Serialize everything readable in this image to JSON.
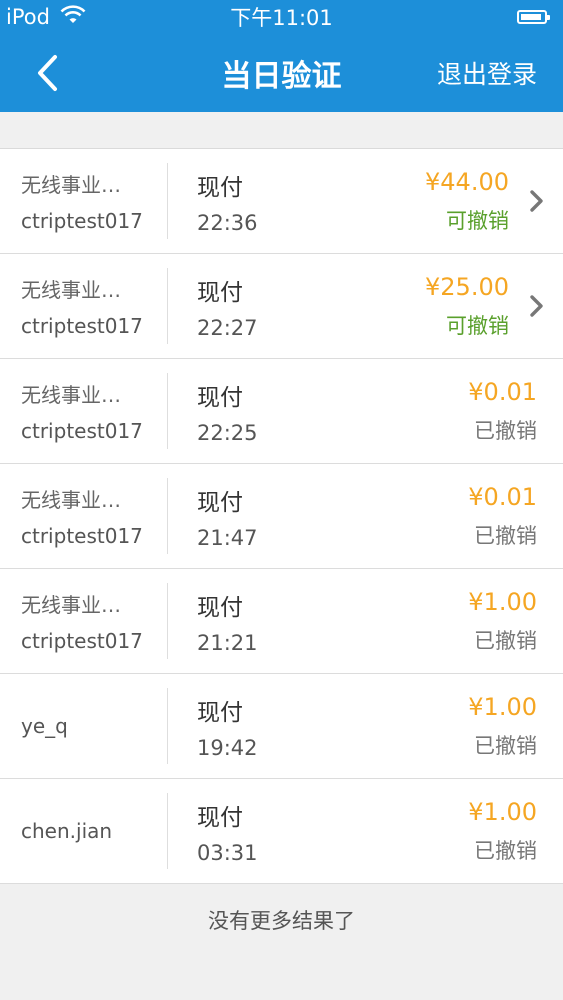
{
  "statusbar": {
    "device": "iPod",
    "time": "下午11:01"
  },
  "nav": {
    "title": "当日验证",
    "logout_label": "退出登录"
  },
  "rows": [
    {
      "merchant": "无线事业…",
      "account": "ctriptest017",
      "pay_type": "现付",
      "time": "22:36",
      "amount": "¥44.00",
      "status": "可撤销",
      "revocable": true
    },
    {
      "merchant": "无线事业…",
      "account": "ctriptest017",
      "pay_type": "现付",
      "time": "22:27",
      "amount": "¥25.00",
      "status": "可撤销",
      "revocable": true
    },
    {
      "merchant": "无线事业…",
      "account": "ctriptest017",
      "pay_type": "现付",
      "time": "22:25",
      "amount": "¥0.01",
      "status": "已撤销",
      "revocable": false
    },
    {
      "merchant": "无线事业…",
      "account": "ctriptest017",
      "pay_type": "现付",
      "time": "21:47",
      "amount": "¥0.01",
      "status": "已撤销",
      "revocable": false
    },
    {
      "merchant": "无线事业…",
      "account": "ctriptest017",
      "pay_type": "现付",
      "time": "21:21",
      "amount": "¥1.00",
      "status": "已撤销",
      "revocable": false
    },
    {
      "merchant": "",
      "account": "ye_q",
      "pay_type": "现付",
      "time": "19:42",
      "amount": "¥1.00",
      "status": "已撤销",
      "revocable": false
    },
    {
      "merchant": "",
      "account": "chen.jian",
      "pay_type": "现付",
      "time": "03:31",
      "amount": "¥1.00",
      "status": "已撤销",
      "revocable": false
    }
  ],
  "footer": {
    "text": "没有更多结果了"
  },
  "colors": {
    "primary": "#1d8fd9",
    "amount": "#f5a623",
    "revocable": "#5aa02c"
  }
}
